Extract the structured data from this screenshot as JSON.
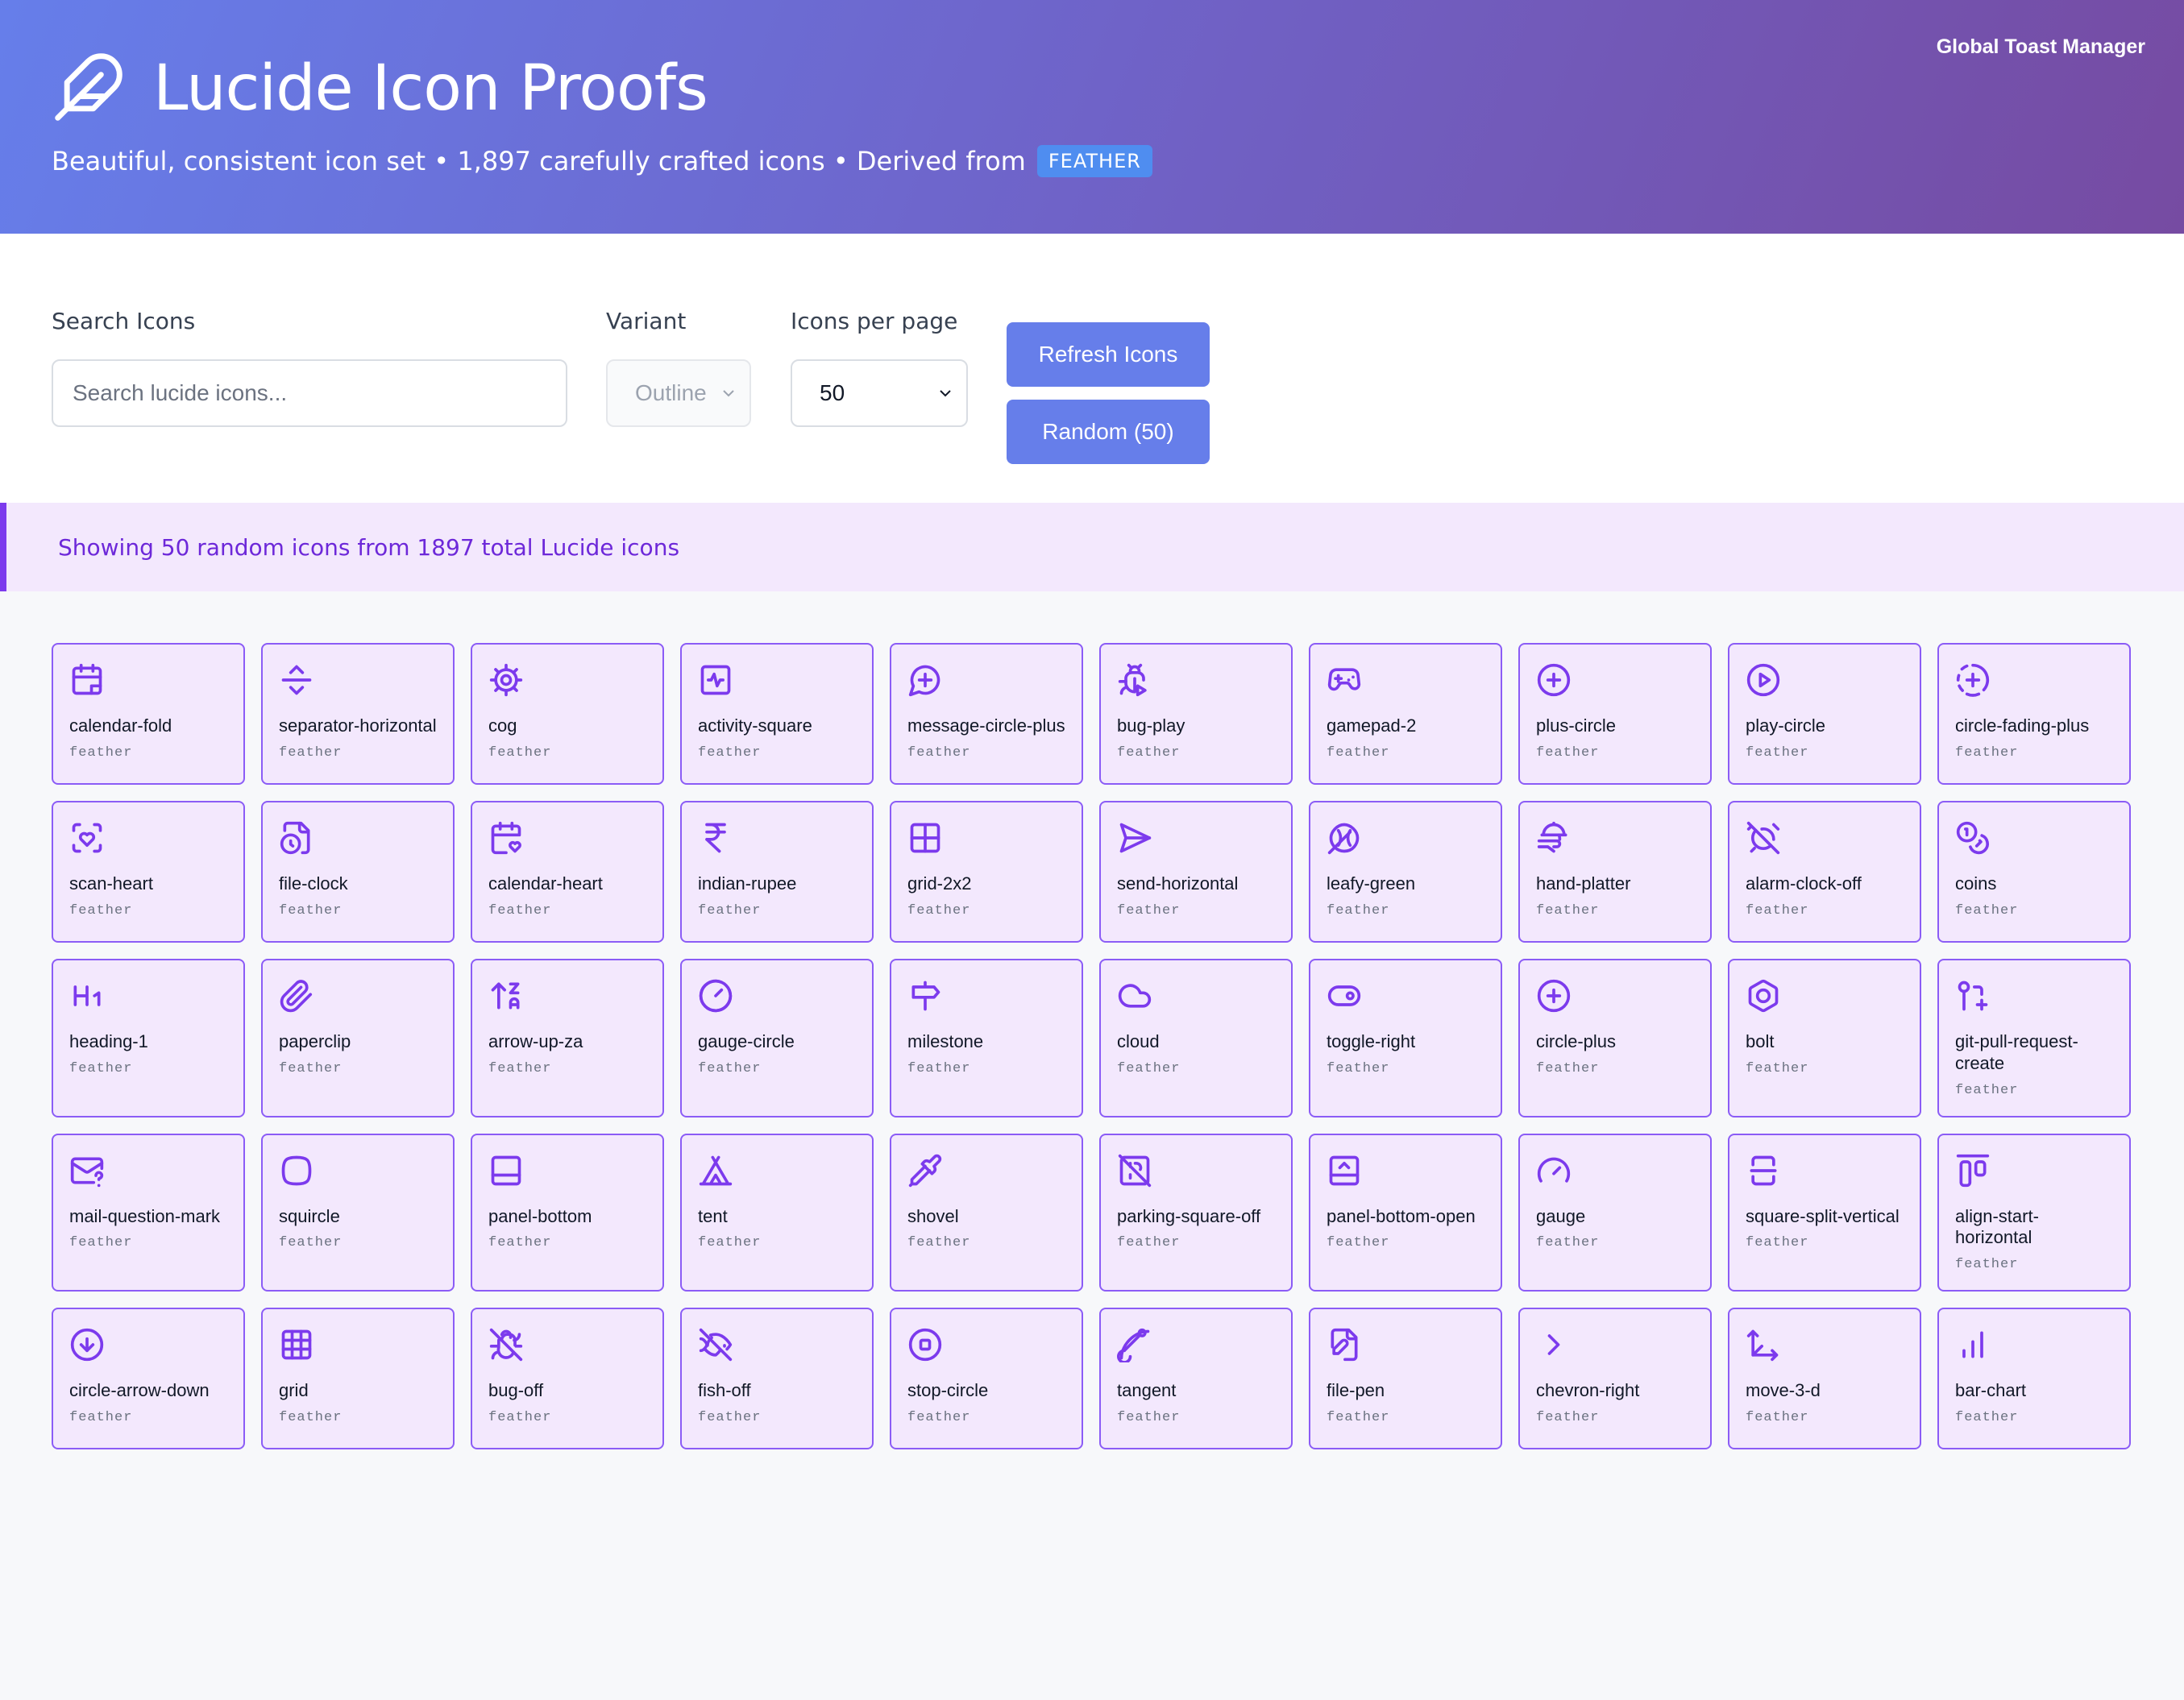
{
  "header": {
    "title": "Lucide Icon Proofs",
    "subtitle": "Beautiful, consistent icon set • 1,897 carefully crafted icons • Derived from",
    "badge": "FEATHER",
    "toast_link": "Global Toast Manager",
    "logo_icon": "feather-icon"
  },
  "controls": {
    "search_label": "Search Icons",
    "search_placeholder": "Search lucide icons...",
    "variant_label": "Variant",
    "variant_value": "Outline",
    "per_page_label": "Icons per page",
    "per_page_value": "50",
    "refresh_label": "Refresh Icons",
    "random_label": "Random (50)"
  },
  "info": {
    "message": "Showing 50 random icons from 1897 total Lucide icons"
  },
  "colors": {
    "accent": "#7c3aed",
    "header_start": "#667eea",
    "header_end": "#764ba2",
    "card_bg": "#f3e8fd",
    "button": "#667eea"
  },
  "icons": [
    {
      "name": "calendar-fold",
      "variant": "feather"
    },
    {
      "name": "separator-horizontal",
      "variant": "feather"
    },
    {
      "name": "cog",
      "variant": "feather"
    },
    {
      "name": "activity-square",
      "variant": "feather"
    },
    {
      "name": "message-circle-plus",
      "variant": "feather"
    },
    {
      "name": "bug-play",
      "variant": "feather"
    },
    {
      "name": "gamepad-2",
      "variant": "feather"
    },
    {
      "name": "plus-circle",
      "variant": "feather"
    },
    {
      "name": "play-circle",
      "variant": "feather"
    },
    {
      "name": "circle-fading-plus",
      "variant": "feather"
    },
    {
      "name": "scan-heart",
      "variant": "feather"
    },
    {
      "name": "file-clock",
      "variant": "feather"
    },
    {
      "name": "calendar-heart",
      "variant": "feather"
    },
    {
      "name": "indian-rupee",
      "variant": "feather"
    },
    {
      "name": "grid-2x2",
      "variant": "feather"
    },
    {
      "name": "send-horizontal",
      "variant": "feather"
    },
    {
      "name": "leafy-green",
      "variant": "feather"
    },
    {
      "name": "hand-platter",
      "variant": "feather"
    },
    {
      "name": "alarm-clock-off",
      "variant": "feather"
    },
    {
      "name": "coins",
      "variant": "feather"
    },
    {
      "name": "heading-1",
      "variant": "feather"
    },
    {
      "name": "paperclip",
      "variant": "feather"
    },
    {
      "name": "arrow-up-za",
      "variant": "feather"
    },
    {
      "name": "gauge-circle",
      "variant": "feather"
    },
    {
      "name": "milestone",
      "variant": "feather"
    },
    {
      "name": "cloud",
      "variant": "feather"
    },
    {
      "name": "toggle-right",
      "variant": "feather"
    },
    {
      "name": "circle-plus",
      "variant": "feather"
    },
    {
      "name": "bolt",
      "variant": "feather"
    },
    {
      "name": "git-pull-request-create",
      "variant": "feather"
    },
    {
      "name": "mail-question-mark",
      "variant": "feather"
    },
    {
      "name": "squircle",
      "variant": "feather"
    },
    {
      "name": "panel-bottom",
      "variant": "feather"
    },
    {
      "name": "tent",
      "variant": "feather"
    },
    {
      "name": "shovel",
      "variant": "feather"
    },
    {
      "name": "parking-square-off",
      "variant": "feather"
    },
    {
      "name": "panel-bottom-open",
      "variant": "feather"
    },
    {
      "name": "gauge",
      "variant": "feather"
    },
    {
      "name": "square-split-vertical",
      "variant": "feather"
    },
    {
      "name": "align-start-horizontal",
      "variant": "feather"
    },
    {
      "name": "circle-arrow-down",
      "variant": "feather"
    },
    {
      "name": "grid",
      "variant": "feather"
    },
    {
      "name": "bug-off",
      "variant": "feather"
    },
    {
      "name": "fish-off",
      "variant": "feather"
    },
    {
      "name": "stop-circle",
      "variant": "feather"
    },
    {
      "name": "tangent",
      "variant": "feather"
    },
    {
      "name": "file-pen",
      "variant": "feather"
    },
    {
      "name": "chevron-right",
      "variant": "feather"
    },
    {
      "name": "move-3-d",
      "variant": "feather"
    },
    {
      "name": "bar-chart",
      "variant": "feather"
    }
  ]
}
